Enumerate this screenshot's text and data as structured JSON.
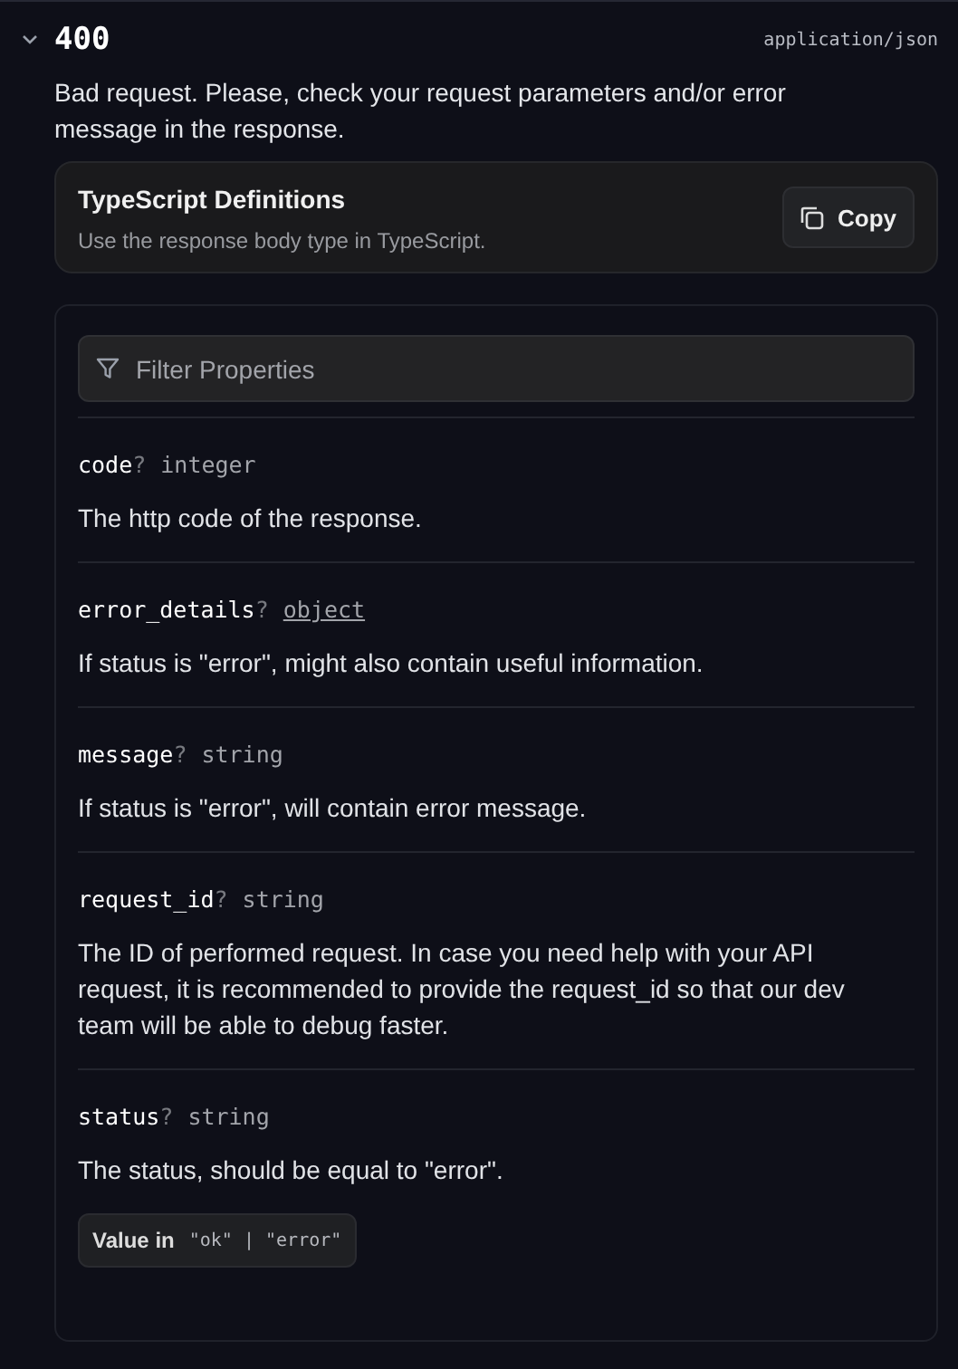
{
  "response": {
    "expanded": true,
    "status_code": "400",
    "content_type": "application/json",
    "description": "Bad request. Please, check your request parameters and/or error message in the response."
  },
  "typescript_card": {
    "title": "TypeScript Definitions",
    "subtitle": "Use the response body type in TypeScript.",
    "button": "Copy"
  },
  "filter": {
    "placeholder": "Filter Properties"
  },
  "properties": [
    {
      "name": "code",
      "optional_mark": "?",
      "type": "integer",
      "type_is_link": false,
      "description": "The http code of the response."
    },
    {
      "name": "error_details",
      "optional_mark": "?",
      "type": "object",
      "type_is_link": true,
      "description": "If status is \"error\", might also contain useful information."
    },
    {
      "name": "message",
      "optional_mark": "?",
      "type": "string",
      "type_is_link": false,
      "description": "If status is \"error\", will contain error message."
    },
    {
      "name": "request_id",
      "optional_mark": "?",
      "type": "string",
      "type_is_link": false,
      "description": "The ID of performed request. In case you need help with your API request, it is recommended to provide the request_id so that our dev team will be able to debug faster."
    },
    {
      "name": "status",
      "optional_mark": "?",
      "type": "string",
      "type_is_link": false,
      "description": "The status, should be equal to \"error\".",
      "enum_label": "Value in",
      "enum_values": "\"ok\" | \"error\""
    }
  ]
}
